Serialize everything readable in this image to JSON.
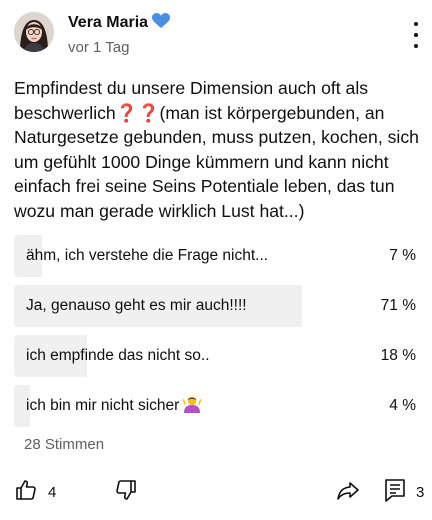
{
  "author": {
    "name": "Vera Maria",
    "badge_icon": "blue-heart-icon",
    "badge_color": "#4a90e2"
  },
  "post": {
    "time": "vor 1 Tag",
    "text": "Empfindest du unsere Dimension auch oft als beschwerlich❓❓(man ist körpergebunden, an Naturgesetze gebunden, muss putzen, kochen, sich um gefühlt 1000 Dinge kümmern und kann nicht einfach frei seine Seins Potentiale leben, das tun wozu man gerade wirklich Lust hat...)"
  },
  "poll": {
    "options": [
      {
        "label": "ähm, ich verstehe die Frage nicht...",
        "percent_text": "7 %",
        "percent": 7
      },
      {
        "label": "Ja, genauso geht es mir auch!!!!",
        "percent_text": "71 %",
        "percent": 71
      },
      {
        "label": "ich empfinde das nicht so..",
        "percent_text": "18 %",
        "percent": 18
      },
      {
        "label": "ich bin mir nicht sicher",
        "emoji_icon": "person-shrugging-icon",
        "percent_text": "4 %",
        "percent": 4
      }
    ],
    "votes": "28 Stimmen"
  },
  "actions": {
    "like_count": "4",
    "reply_count": "3",
    "icons": [
      "thumbs-up-icon",
      "thumbs-down-icon",
      "share-icon",
      "comment-icon",
      "more-vertical-icon"
    ]
  },
  "colors": {
    "bar_fill": "#f0f0f0",
    "text": "#0f0f0f",
    "secondary_text": "#606060"
  }
}
